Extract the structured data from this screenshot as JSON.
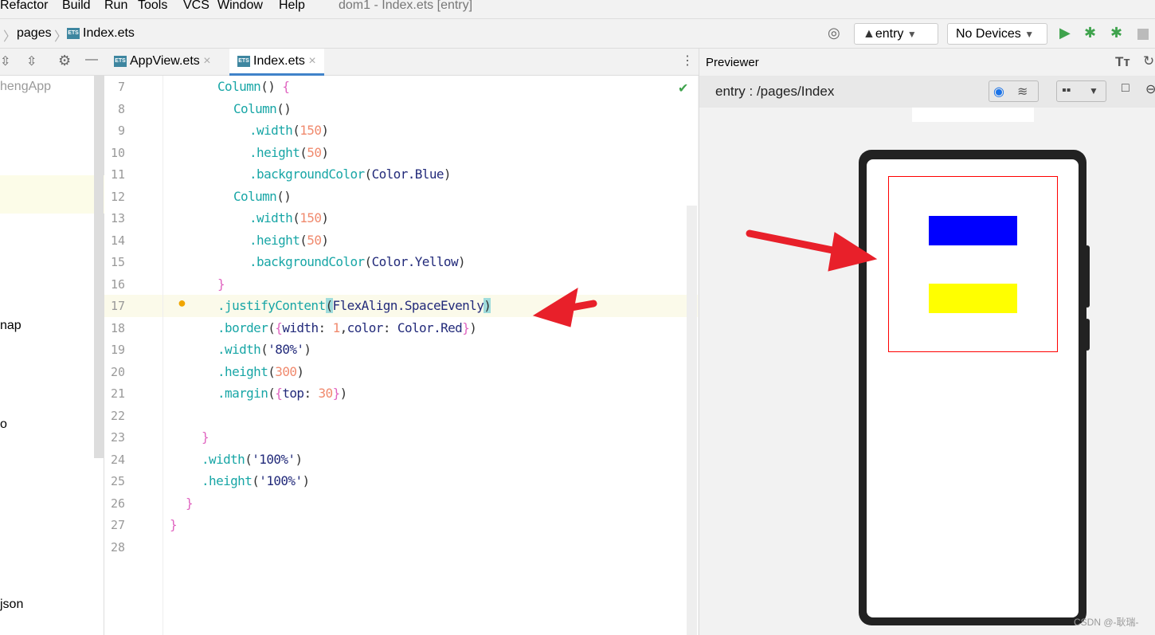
{
  "menu": [
    "Refactor",
    "Build",
    "Run",
    "Tools",
    "VCS",
    "Window",
    "Help"
  ],
  "window_title": "dom1 - Index.ets [entry]",
  "breadcrumb": [
    "pages",
    "Index.ets"
  ],
  "toolbar": {
    "module": "entry",
    "device": "No Devices"
  },
  "tabs": [
    {
      "label": "AppView.ets",
      "active": false
    },
    {
      "label": "Index.ets",
      "active": true
    }
  ],
  "project_tree": [
    "hengApp",
    "nap",
    "o",
    "json"
  ],
  "line_numbers": [
    "7",
    "8",
    "9",
    "10",
    "11",
    "12",
    "13",
    "14",
    "15",
    "16",
    "17",
    "18",
    "19",
    "20",
    "21",
    "22",
    "23",
    "24",
    "25",
    "26",
    "27",
    "28"
  ],
  "code": [
    [
      [
        "f",
        "Column"
      ],
      [
        "s",
        "() "
      ],
      [
        "p",
        "{"
      ]
    ],
    [
      [
        "f",
        "Column"
      ],
      [
        "s",
        "()"
      ]
    ],
    [
      [
        "f",
        ".width"
      ],
      [
        "s",
        "("
      ],
      [
        "n",
        "150"
      ],
      [
        "s",
        ")"
      ]
    ],
    [
      [
        "f",
        ".height"
      ],
      [
        "s",
        "("
      ],
      [
        "n",
        "50"
      ],
      [
        "s",
        ")"
      ]
    ],
    [
      [
        "f",
        ".backgroundColor"
      ],
      [
        "s",
        "("
      ],
      [
        "t",
        "Color.Blue"
      ],
      [
        "s",
        ")"
      ]
    ],
    [
      [
        "f",
        "Column"
      ],
      [
        "s",
        "()"
      ]
    ],
    [
      [
        "f",
        ".width"
      ],
      [
        "s",
        "("
      ],
      [
        "n",
        "150"
      ],
      [
        "s",
        ")"
      ]
    ],
    [
      [
        "f",
        ".height"
      ],
      [
        "s",
        "("
      ],
      [
        "n",
        "50"
      ],
      [
        "s",
        ")"
      ]
    ],
    [
      [
        "f",
        ".backgroundColor"
      ],
      [
        "s",
        "("
      ],
      [
        "t",
        "Color.Yellow"
      ],
      [
        "s",
        ")"
      ]
    ],
    [
      [
        "p",
        "}"
      ]
    ],
    [
      [
        "f",
        ".justifyContent"
      ],
      [
        "s",
        "("
      ],
      [
        "t",
        "FlexAlign.SpaceEvenly"
      ],
      [
        "s",
        ")"
      ]
    ],
    [
      [
        "f",
        ".border"
      ],
      [
        "s",
        "("
      ],
      [
        "p",
        "{"
      ],
      [
        "t",
        "width"
      ],
      [
        "s",
        ": "
      ],
      [
        "n",
        "1"
      ],
      [
        "s",
        ","
      ],
      [
        "t",
        "color"
      ],
      [
        "s",
        ": "
      ],
      [
        "t",
        "Color.Red"
      ],
      [
        "p",
        "}"
      ],
      [
        "s",
        ")"
      ]
    ],
    [
      [
        "f",
        ".width"
      ],
      [
        "s",
        "("
      ],
      [
        "t",
        "'80%'"
      ],
      [
        "s",
        ")"
      ]
    ],
    [
      [
        "f",
        ".height"
      ],
      [
        "s",
        "("
      ],
      [
        "n",
        "300"
      ],
      [
        "s",
        ")"
      ]
    ],
    [
      [
        "f",
        ".margin"
      ],
      [
        "s",
        "("
      ],
      [
        "p",
        "{"
      ],
      [
        "t",
        "top"
      ],
      [
        "s",
        ": "
      ],
      [
        "n",
        "30"
      ],
      [
        "p",
        "}"
      ],
      [
        "s",
        ")"
      ]
    ],
    [],
    [
      [
        "p",
        "}"
      ]
    ],
    [
      [
        "f",
        ".width"
      ],
      [
        "s",
        "("
      ],
      [
        "t",
        "'100%'"
      ],
      [
        "s",
        ")"
      ]
    ],
    [
      [
        "f",
        ".height"
      ],
      [
        "s",
        "("
      ],
      [
        "t",
        "'100%'"
      ],
      [
        "s",
        ")"
      ]
    ],
    [
      [
        "p",
        "}"
      ]
    ],
    [
      [
        "p",
        "}"
      ]
    ],
    []
  ],
  "indent": [
    273,
    293,
    313,
    313,
    313,
    293,
    313,
    313,
    313,
    273,
    273,
    273,
    273,
    273,
    273,
    0,
    253,
    253,
    253,
    233,
    213,
    0
  ],
  "previewer": {
    "title": "Previewer",
    "path": "entry : /pages/Index"
  },
  "preview": {
    "border_color": "#ff0000",
    "box1_color": "#0000ff",
    "box2_color": "#ffff00"
  },
  "watermark": "CSDN @-耿瑞-"
}
